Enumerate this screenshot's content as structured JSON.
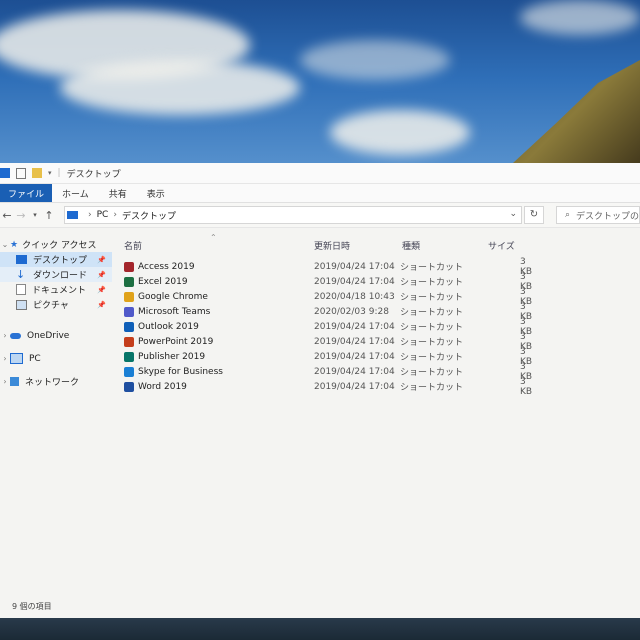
{
  "window": {
    "title": "デスクトップ",
    "tabs": [
      "ファイル",
      "ホーム",
      "共有",
      "表示"
    ],
    "address": {
      "root": "PC",
      "current": "デスクトップ"
    },
    "search_placeholder": "デスクトップの検",
    "status": "9 個の項目"
  },
  "nav": {
    "quick_access": "クイック アクセス",
    "items": [
      {
        "label": "デスクトップ",
        "color": "#1e6ad0"
      },
      {
        "label": "ダウンロード",
        "color": "#1e6ad0"
      },
      {
        "label": "ドキュメント",
        "color": "#8a8a8a"
      },
      {
        "label": "ピクチャ",
        "color": "#5a8ac0"
      }
    ],
    "onedrive": "OneDrive",
    "pc": "PC",
    "network": "ネットワーク"
  },
  "columns": {
    "name": "名前",
    "date": "更新日時",
    "type": "種類",
    "size": "サイズ"
  },
  "files": [
    {
      "name": "Access 2019",
      "date": "2019/04/24 17:04",
      "type": "ショートカット",
      "size": "3 KB",
      "color": "#a4262c"
    },
    {
      "name": "Excel 2019",
      "date": "2019/04/24 17:04",
      "type": "ショートカット",
      "size": "3 KB",
      "color": "#1d6f42"
    },
    {
      "name": "Google Chrome",
      "date": "2020/04/18 10:43",
      "type": "ショートカット",
      "size": "3 KB",
      "color": "#e0a21a"
    },
    {
      "name": "Microsoft Teams",
      "date": "2020/02/03 9:28",
      "type": "ショートカット",
      "size": "3 KB",
      "color": "#5059c9"
    },
    {
      "name": "Outlook 2019",
      "date": "2019/04/24 17:04",
      "type": "ショートカット",
      "size": "3 KB",
      "color": "#0f5fb8"
    },
    {
      "name": "PowerPoint 2019",
      "date": "2019/04/24 17:04",
      "type": "ショートカット",
      "size": "3 KB",
      "color": "#c43e1c"
    },
    {
      "name": "Publisher 2019",
      "date": "2019/04/24 17:04",
      "type": "ショートカット",
      "size": "3 KB",
      "color": "#077568"
    },
    {
      "name": "Skype for Business",
      "date": "2019/04/24 17:04",
      "type": "ショートカット",
      "size": "3 KB",
      "color": "#1a7fd4"
    },
    {
      "name": "Word 2019",
      "date": "2019/04/24 17:04",
      "type": "ショートカット",
      "size": "3 KB",
      "color": "#1f4fa0"
    }
  ]
}
